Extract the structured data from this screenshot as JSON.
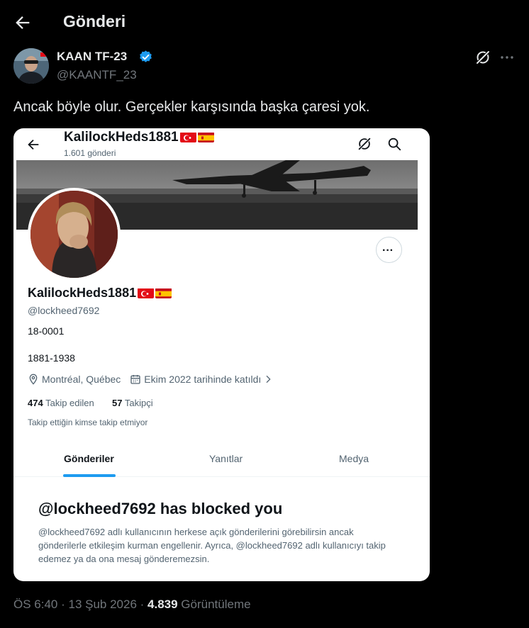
{
  "header": {
    "title": "Gönderi"
  },
  "tweet": {
    "author_name": "KAAN TF-23",
    "author_handle": "@KAANTF_23",
    "text": "Ancak böyle olur. Gerçekler karşısında başka çaresi yok.",
    "time": "ÖS 6:40",
    "date": "13 Şub 2026",
    "views": "4.839",
    "views_label": "Görüntüleme"
  },
  "screenshot": {
    "profile_name": "KalilockHeds1881",
    "post_count": "1.601 gönderi",
    "handle": "@lockheed7692",
    "bio_line1": "18-0001",
    "bio_line2": "1881-1938",
    "location": "Montréal, Québec",
    "joined": "Ekim 2022 tarihinde katıldı",
    "following_count": "474",
    "following_label": "Takip edilen",
    "followers_count": "57",
    "followers_label": "Takipçi",
    "mutual_note": "Takip ettiğin kimse takip etmiyor",
    "tabs": [
      "Gönderiler",
      "Yanıtlar",
      "Medya"
    ],
    "blocked_title": "@lockheed7692 has blocked you",
    "blocked_text": "@lockheed7692 adlı kullanıcının herkese açık gönderilerini görebilirsin ancak gönderilerle etkileşim kurman engellenir. Ayrıca, @lockheed7692 adlı kullanıcıyı takip edemez ya da ona mesaj gönderemezsin."
  },
  "colors": {
    "accent": "#1d9bf0",
    "background": "#000000",
    "muted": "#71767b"
  },
  "icons": [
    "back-arrow-icon",
    "verified-badge-icon",
    "grok-icon",
    "more-icon",
    "search-icon",
    "location-icon",
    "calendar-icon",
    "chevron-right-icon",
    "flag-turkey-icon",
    "flag-spain-icon"
  ]
}
